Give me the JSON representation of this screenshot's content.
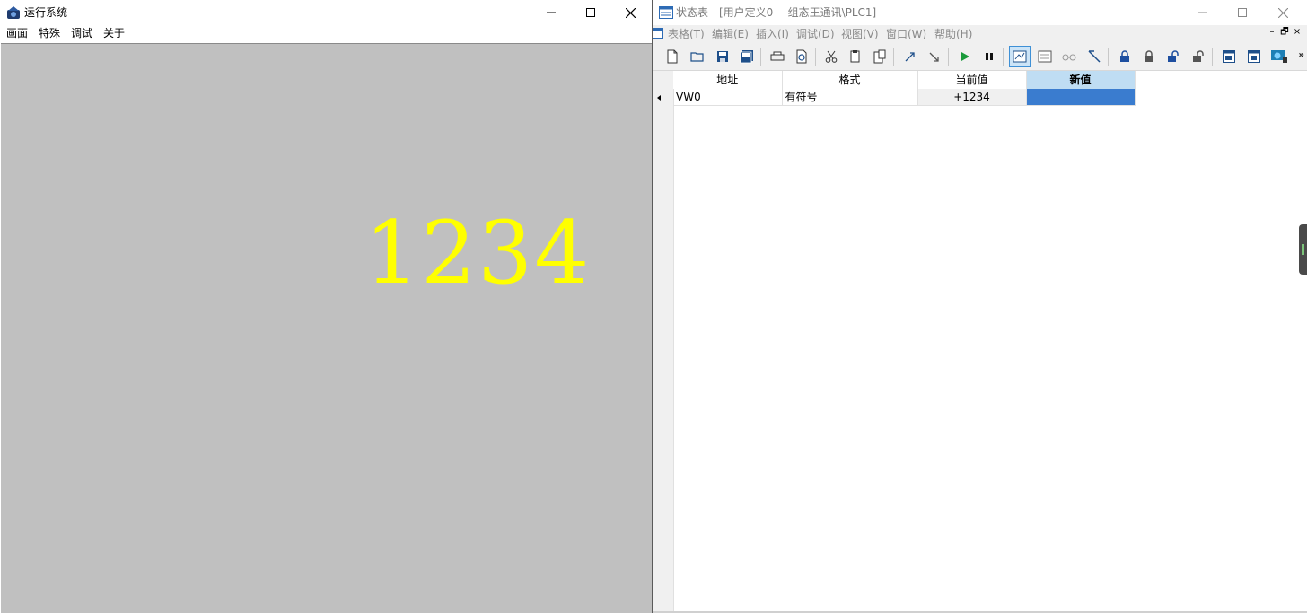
{
  "left_window": {
    "title": "运行系统",
    "menu": [
      "画面",
      "特殊",
      "调试",
      "关于"
    ],
    "display_value": "1234",
    "colors": {
      "canvas": "#c0c0c0",
      "value_text": "#ffff00"
    },
    "controls": {
      "minimize_icon": "minimize-icon",
      "maximize_icon": "maximize-icon",
      "close_icon": "close-icon"
    }
  },
  "right_window": {
    "title": "状态表 - [用户定义0 -- 组态王通讯\\PLC1]",
    "menu": [
      "表格(T)",
      "编辑(E)",
      "插入(I)",
      "调试(D)",
      "视图(V)",
      "窗口(W)",
      "帮助(H)"
    ],
    "mdi_controls": [
      "–",
      "🗗",
      "×"
    ],
    "toolbar": [
      "new-icon",
      "open-icon",
      "save-icon",
      "save-all-icon",
      "print-icon",
      "print-preview-icon",
      "cut-icon",
      "copy-icon",
      "paste-icon",
      "undo-icon",
      "redo-icon",
      "run-icon",
      "pause-icon",
      "status-chart-icon",
      "trend-icon",
      "glasses-icon",
      "write-icon",
      "lock-icon",
      "unlock-icon",
      "force-icon",
      "unforce-icon",
      "window-1-icon",
      "window-2-icon",
      "network-icon"
    ],
    "table": {
      "headers": [
        "地址",
        "格式",
        "当前值",
        "新值"
      ],
      "rows": [
        {
          "address": "VW0",
          "format": "有符号",
          "current": "+1234",
          "new": ""
        }
      ]
    },
    "colors": {
      "selected_header": "#bfddf3",
      "new_value_cell": "#3a7ccf"
    }
  }
}
